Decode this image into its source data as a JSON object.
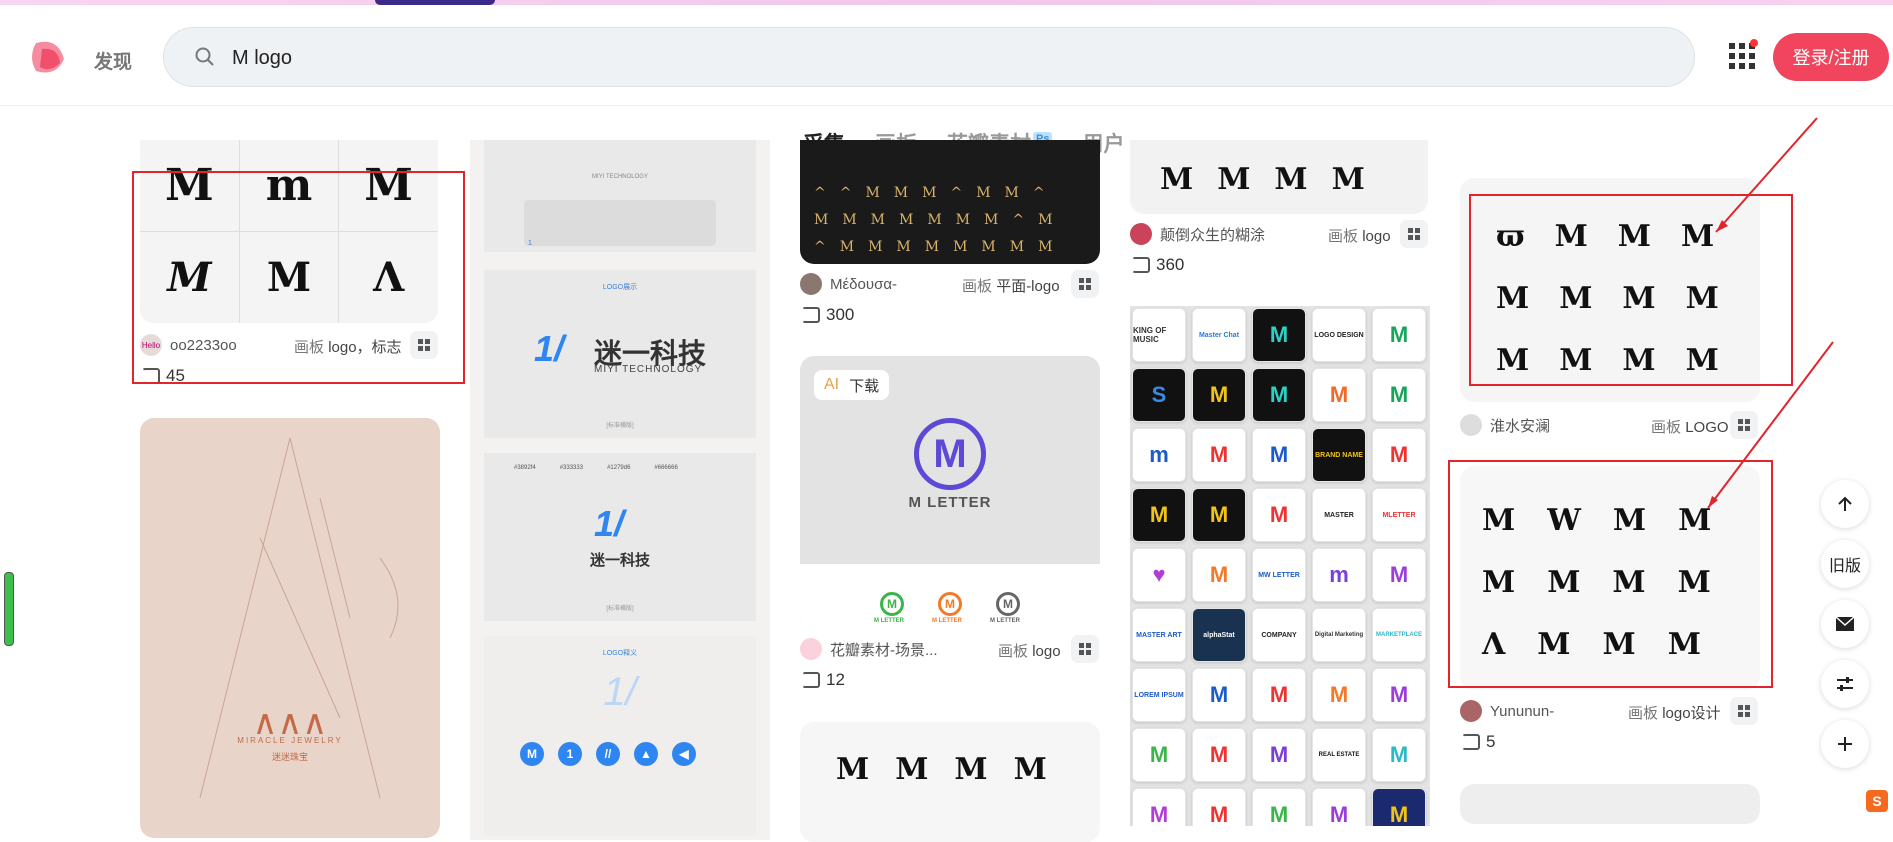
{
  "header": {
    "discover_label": "发现",
    "search_value": "M logo",
    "login_label": "登录/注册"
  },
  "tabs": [
    {
      "label": "采集",
      "active": true
    },
    {
      "label": "画板"
    },
    {
      "label": "花瓣素材",
      "badge": "Ps"
    },
    {
      "label": "用户"
    }
  ],
  "pins": {
    "col1_top": {
      "user": "oo2233oo",
      "avatar_text": "Hello",
      "board_prefix": "画板",
      "board": "logo，标志",
      "count": "45"
    },
    "col3_a": {
      "user": "Μέδουσα-",
      "board_prefix": "画板",
      "board": "平面-logo",
      "count": "300"
    },
    "col3_b": {
      "badge_ai": "AI",
      "badge_download": "下载",
      "image_title": "M LETTER",
      "sub_labels": [
        "M LETTER",
        "M LETTER",
        "M LETTER"
      ],
      "user": "花瓣素材-场景...",
      "board_prefix": "画板",
      "board": "logo",
      "count": "12"
    },
    "col4_a": {
      "user": "颠倒众生的糊涂",
      "board_prefix": "画板",
      "board": "logo",
      "count": "360"
    },
    "col5_a": {
      "user": "淮水安澜",
      "board_prefix": "画板",
      "board": "LOGO"
    },
    "col5_b": {
      "user": "Yununun-",
      "board_prefix": "画板",
      "board": "logo设计",
      "count": "5"
    },
    "col2": {
      "logo_demo": "LOGO展示",
      "brand_cn": "迷一科技",
      "brand_en": "MIYI TECHNOLOGY",
      "brand_small": "[标准横版]",
      "colors": [
        "#3892f4",
        "#333333",
        "#1279d6",
        "#666666"
      ],
      "meaning_title": "LOGO释义",
      "top_caption": "MIYI TECHNOLOGY",
      "top_page": "1"
    },
    "col1_bottom": {
      "brand": "MIRACLE  JEWELRY",
      "brand_cn": "迷迷珠宝"
    }
  },
  "grid_tile_labels": [
    "KING OF MUSIC",
    "Master Chat",
    "LOGO DESIGN",
    "LOGO DESIGN",
    "MASTER",
    "MLETTER",
    "COMPANY",
    "LOREM IPSUM",
    "MARKETPLACE",
    "Digital Marketing",
    "alphaStat",
    "MASTER ART",
    "REAL ESTATE",
    "BRAND NAME",
    "MW LETTER"
  ],
  "side_toolbar": {
    "old_version": "旧版"
  },
  "colors": {
    "accent": "#f0455d",
    "highlight_box": "#e0262c"
  }
}
